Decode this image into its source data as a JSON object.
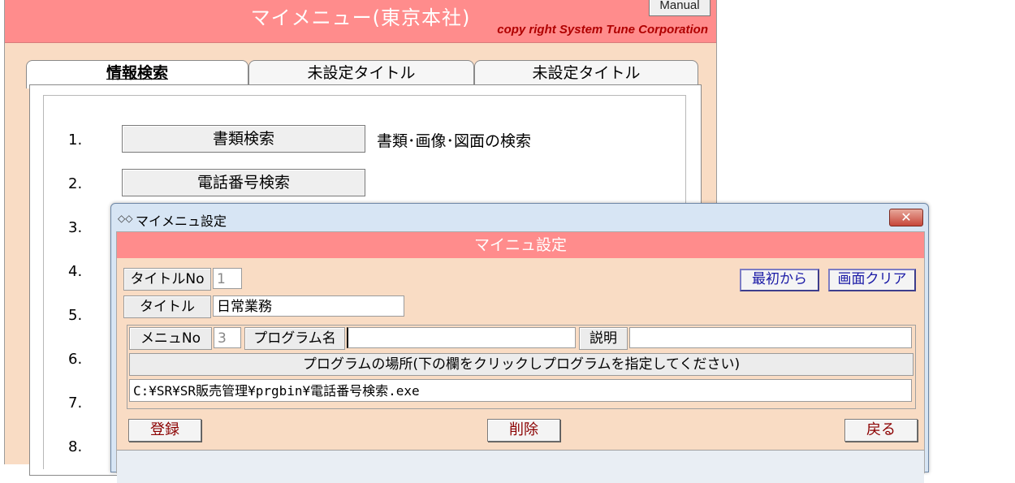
{
  "main": {
    "title": "マイメニュー(東京本社)",
    "copyright": "copy right System Tune Corporation",
    "manual_label": "Manual",
    "tabs": [
      {
        "label": "情報検索"
      },
      {
        "label": "未設定タイトル"
      },
      {
        "label": "未設定タイトル"
      }
    ],
    "menu_items": [
      {
        "num": "1.",
        "label": "書類検索",
        "desc": "書類･画像･図面の検索"
      },
      {
        "num": "2.",
        "label": "電話番号検索",
        "desc": ""
      },
      {
        "num": "3.",
        "label": "",
        "desc": ""
      },
      {
        "num": "4.",
        "label": "",
        "desc": ""
      },
      {
        "num": "5.",
        "label": "",
        "desc": ""
      },
      {
        "num": "6.",
        "label": "",
        "desc": ""
      },
      {
        "num": "7.",
        "label": "",
        "desc": ""
      },
      {
        "num": "8.",
        "label": "",
        "desc": ""
      }
    ]
  },
  "dialog": {
    "window_title": "マイメニュ設定",
    "header": "マイニュ設定",
    "close_glyph": "✕",
    "title_no_label": "タイトルNo",
    "title_no_value": "1",
    "title_label": "タイトル",
    "title_value": "日常業務",
    "first_button": "最初から",
    "clear_button": "画面クリア",
    "menu_no_label": "メニュNo",
    "menu_no_value": "3",
    "program_name_label": "プログラム名",
    "program_name_value": "",
    "description_label": "説明",
    "description_value": "",
    "location_header": "プログラムの場所(下の欄をクリックしプログラムを指定してください)",
    "path_value": "C:¥SR¥SR販売管理¥prgbin¥電話番号検索.exe",
    "register_button": "登録",
    "delete_button": "削除",
    "back_button": "戻る"
  },
  "colors": {
    "header_red": "#ff8c8c",
    "panel_peach": "#f9dcc4",
    "copyright_red": "#b00000",
    "button_blue_text": "#1a1aa6",
    "button_red_text": "#8b0000"
  }
}
